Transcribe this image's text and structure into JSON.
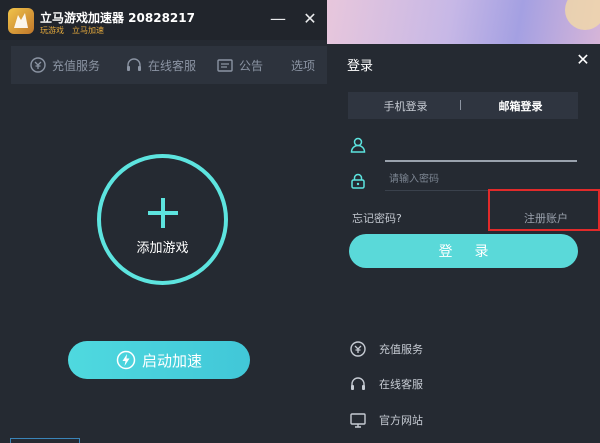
{
  "app": {
    "title": "立马游戏加速器 20828217",
    "subtitle": "玩游戏　立马加速",
    "minimize_label": "—",
    "close_label": "✕"
  },
  "nav": {
    "items": [
      {
        "label": "充值服务",
        "icon": "recharge-icon"
      },
      {
        "label": "在线客服",
        "icon": "headset-icon"
      },
      {
        "label": "公告",
        "icon": "notice-icon"
      },
      {
        "label": "选项",
        "icon": ""
      }
    ]
  },
  "main": {
    "add_game_label": "添加游戏",
    "start_label": "启动加速"
  },
  "login": {
    "title": "登录",
    "close_label": "✕",
    "tabs": [
      {
        "label": "手机登录",
        "active": false
      },
      {
        "label": "邮箱登录",
        "active": true
      }
    ],
    "username_value": "",
    "password_placeholder": "请输入密码",
    "forgot_label": "忘记密码?",
    "register_label": "注册账户",
    "login_button": "登录",
    "links": [
      {
        "label": "充值服务",
        "icon": "recharge-icon"
      },
      {
        "label": "在线客服",
        "icon": "headset-icon"
      },
      {
        "label": "官方网站",
        "icon": "monitor-icon"
      }
    ]
  },
  "colors": {
    "accent": "#5de4df",
    "highlight": "#e12a2a"
  }
}
